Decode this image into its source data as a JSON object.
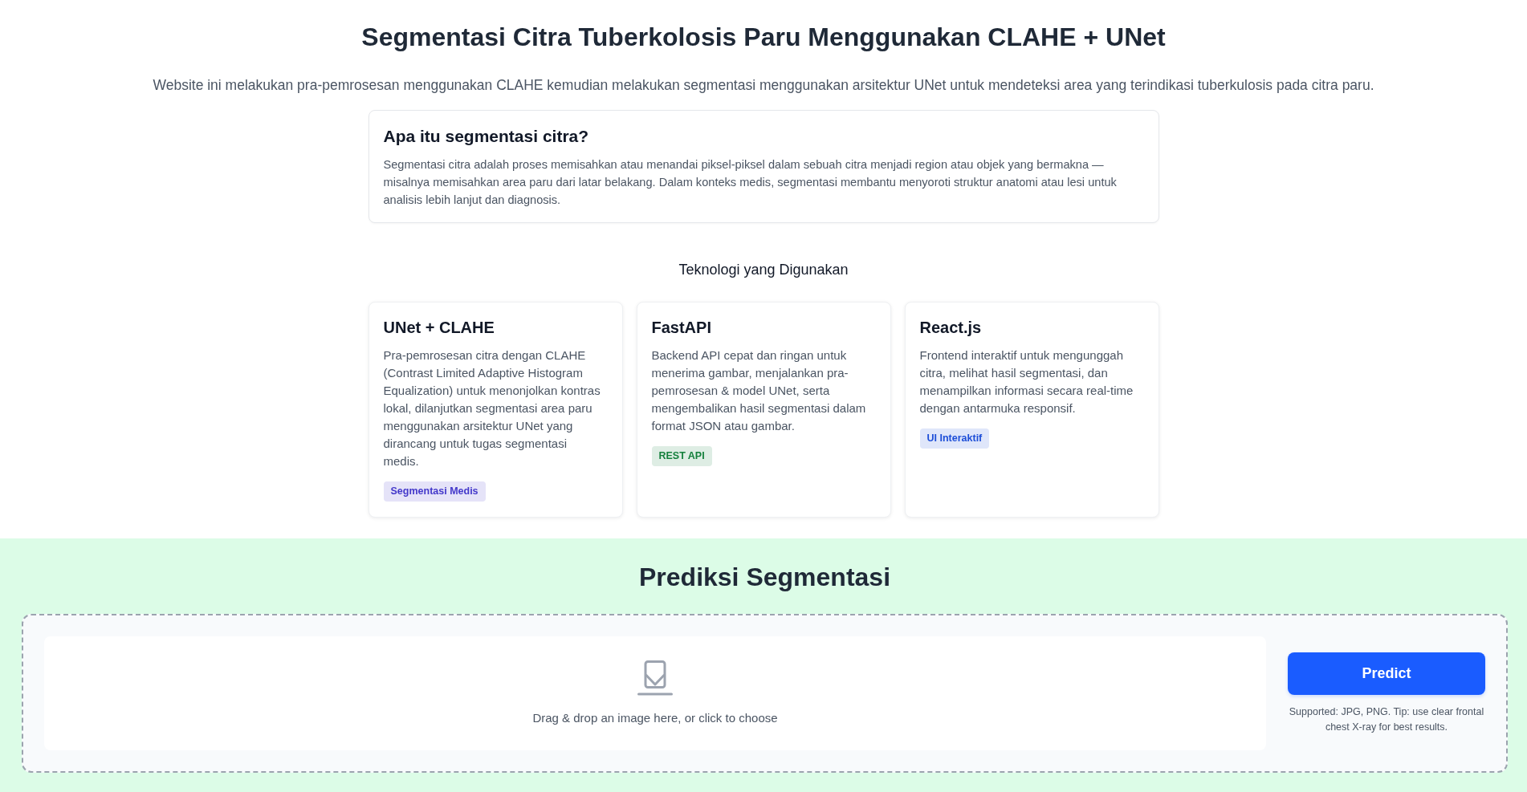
{
  "header": {
    "title": "Segmentasi Citra Tuberkolosis Paru Menggunakan CLAHE + UNet",
    "subtitle": "Website ini melakukan pra-pemrosesan menggunakan CLAHE kemudian melakukan segmentasi menggunakan arsitektur UNet untuk mendeteksi area yang terindikasi tuberkulosis pada citra paru."
  },
  "intro_card": {
    "title": "Apa itu segmentasi citra?",
    "body": "Segmentasi citra adalah proses memisahkan atau menandai piksel-piksel dalam sebuah citra menjadi region atau objek yang bermakna — misalnya memisahkan area paru dari latar belakang. Dalam konteks medis, segmentasi membantu menyoroti struktur anatomi atau lesi untuk analisis lebih lanjut dan diagnosis."
  },
  "technologies": {
    "heading": "Teknologi yang Digunakan",
    "cards": [
      {
        "title": "UNet + CLAHE",
        "description": "Pra-pemrosesan citra dengan CLAHE (Contrast Limited Adaptive Histogram Equalization) untuk menonjolkan kontras lokal, dilanjutkan segmentasi area paru menggunakan arsitektur UNet yang dirancang untuk tugas segmentasi medis.",
        "tag": {
          "label": "Segmentasi Medis",
          "color": "#4338ca"
        }
      },
      {
        "title": "FastAPI",
        "description": "Backend API cepat dan ringan untuk menerima gambar, menjalankan pra-pemrosesan & model UNet, serta mengembalikan hasil segmentasi dalam format JSON atau gambar.",
        "tag": {
          "label": "REST API",
          "color": "#15803d"
        }
      },
      {
        "title": "React.js",
        "description": "Frontend interaktif untuk mengunggah citra, melihat hasil segmentasi, dan menampilkan informasi secara real-time dengan antarmuka responsif.",
        "tag": {
          "label": "UI Interaktif",
          "color": "#1d4ed8"
        }
      }
    ]
  },
  "prediction": {
    "title": "Prediksi Segmentasi",
    "dropzone": {
      "text": "Drag & drop an image here, or click to choose"
    },
    "predict_button": {
      "label": "Predict"
    },
    "hint": "Supported: JPG, PNG. Tip: use clear frontal chest X-ray for best results."
  }
}
